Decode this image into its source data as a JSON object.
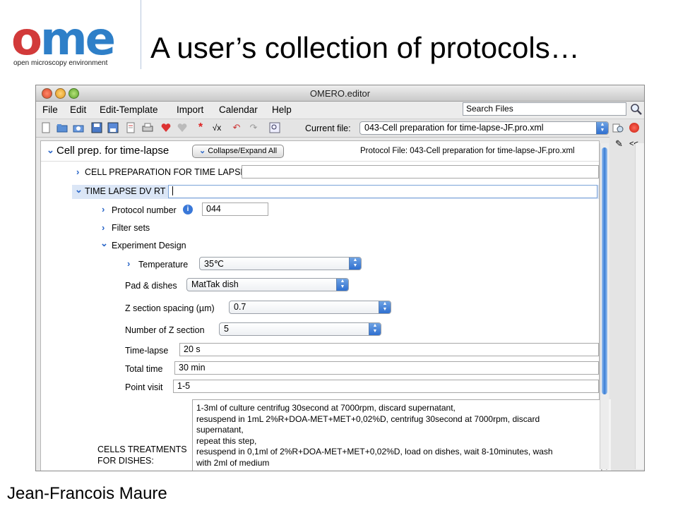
{
  "slide": {
    "logo_text": "ome",
    "logo_subtitle": "open microscopy environment",
    "title": "A user’s collection of protocols…",
    "author": "Jean-Francois Maure"
  },
  "window": {
    "title": "OMERO.editor",
    "menus": [
      "File",
      "Edit",
      "Edit-Template",
      "Import",
      "Calendar",
      "Help"
    ],
    "search_value": "Search Files",
    "current_file_label": "Current file:",
    "current_file": "043-Cell preparation for time-lapse-JF.pro.xml"
  },
  "panel": {
    "root_title": "Cell prep. for time-lapse",
    "collapse_btn": "Collapse/Expand All",
    "protocol_file": "Protocol File: 043-Cell preparation for time-lapse-JF.pro.xml",
    "section1": "CELL PREPARATION FOR TIME LAPSE",
    "section2": "TIME LAPSE DV RT",
    "protocol_number_label": "Protocol number",
    "protocol_number": "044",
    "filter_sets": "Filter sets",
    "experiment_design": "Experiment Design",
    "temperature_label": "Temperature",
    "temperature": "35℃",
    "pad_label": "Pad & dishes",
    "pad": "MatTak dish",
    "z_spacing_label": "Z section spacing (µm)",
    "z_spacing": "0.7",
    "z_number_label": "Number of Z section",
    "z_number": "5",
    "timelapse_label": "Time-lapse",
    "timelapse": "20 s",
    "total_label": "Total time",
    "total": "30 min",
    "point_label": "Point visit",
    "point": "1-5",
    "treatments_label_1": "CELLS TREATMENTS",
    "treatments_label_2": "FOR DISHES:",
    "notes": [
      "1-3ml of culture centrifug 30second at 7000rpm, discard supernatant,",
      "resuspend in 1mL 2%R+DOA-MET+MET+0,02%D, centrifug 30second at 7000rpm, discard",
      "supernatant,",
      "repeat this step,",
      "resuspend in 0,1ml of 2%R+DOA-MET+MET+0,02%D, load on dishes, wait 8-10minutes, wash",
      "with 2ml of medium"
    ]
  },
  "colors": {
    "accent": "#2a66c8",
    "logo_red": "#d23a3a",
    "logo_blue": "#2e7fc8"
  }
}
